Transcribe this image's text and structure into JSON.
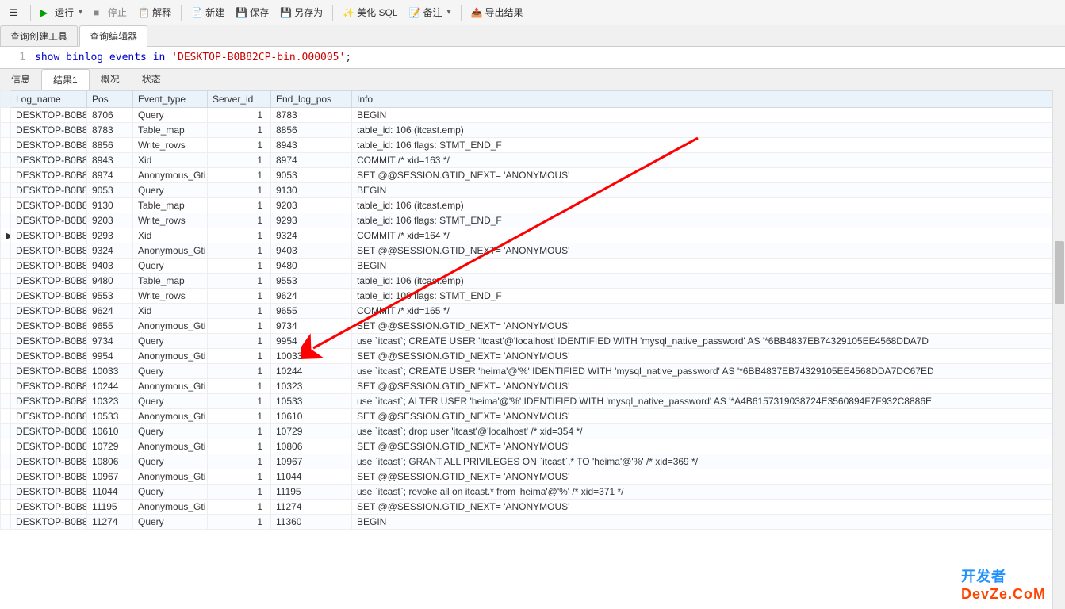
{
  "toolbar": {
    "run": "运行",
    "stop": "停止",
    "explain": "解释",
    "new": "新建",
    "save": "保存",
    "saveAs": "另存为",
    "beautify": "美化 SQL",
    "comment": "备注",
    "export": "导出结果"
  },
  "editorTabs": {
    "builder": "查询创建工具",
    "editor": "查询编辑器"
  },
  "sql": {
    "lineNum": "1",
    "part1": "show binlog events in ",
    "part2": "'DESKTOP-B0B82CP-bin.000005'",
    "part3": ";"
  },
  "resultTabs": {
    "info": "信息",
    "result1": "结果1",
    "profile": "概况",
    "status": "状态"
  },
  "columns": {
    "log_name": "Log_name",
    "pos": "Pos",
    "event_type": "Event_type",
    "server_id": "Server_id",
    "end_log_pos": "End_log_pos",
    "info": "Info"
  },
  "rows": [
    {
      "log": "DESKTOP-B0B8",
      "pos": "8706",
      "et": "Query",
      "sid": "1",
      "elp": "8783",
      "info": "BEGIN"
    },
    {
      "log": "DESKTOP-B0B8",
      "pos": "8783",
      "et": "Table_map",
      "sid": "1",
      "elp": "8856",
      "info": "table_id: 106 (itcast.emp)"
    },
    {
      "log": "DESKTOP-B0B8",
      "pos": "8856",
      "et": "Write_rows",
      "sid": "1",
      "elp": "8943",
      "info": "table_id: 106 flags: STMT_END_F"
    },
    {
      "log": "DESKTOP-B0B8",
      "pos": "8943",
      "et": "Xid",
      "sid": "1",
      "elp": "8974",
      "info": "COMMIT /* xid=163 */"
    },
    {
      "log": "DESKTOP-B0B8",
      "pos": "8974",
      "et": "Anonymous_Gti",
      "sid": "1",
      "elp": "9053",
      "info": "SET @@SESSION.GTID_NEXT= 'ANONYMOUS'"
    },
    {
      "log": "DESKTOP-B0B8",
      "pos": "9053",
      "et": "Query",
      "sid": "1",
      "elp": "9130",
      "info": "BEGIN"
    },
    {
      "log": "DESKTOP-B0B8",
      "pos": "9130",
      "et": "Table_map",
      "sid": "1",
      "elp": "9203",
      "info": "table_id: 106 (itcast.emp)"
    },
    {
      "log": "DESKTOP-B0B8",
      "pos": "9203",
      "et": "Write_rows",
      "sid": "1",
      "elp": "9293",
      "info": "table_id: 106 flags: STMT_END_F"
    },
    {
      "log": "DESKTOP-B0B8",
      "pos": "9293",
      "et": "Xid",
      "sid": "1",
      "elp": "9324",
      "info": "COMMIT /* xid=164 */",
      "marker": "▶"
    },
    {
      "log": "DESKTOP-B0B8",
      "pos": "9324",
      "et": "Anonymous_Gti",
      "sid": "1",
      "elp": "9403",
      "info": "SET @@SESSION.GTID_NEXT= 'ANONYMOUS'"
    },
    {
      "log": "DESKTOP-B0B8",
      "pos": "9403",
      "et": "Query",
      "sid": "1",
      "elp": "9480",
      "info": "BEGIN"
    },
    {
      "log": "DESKTOP-B0B8",
      "pos": "9480",
      "et": "Table_map",
      "sid": "1",
      "elp": "9553",
      "info": "table_id: 106 (itcast.emp)"
    },
    {
      "log": "DESKTOP-B0B8",
      "pos": "9553",
      "et": "Write_rows",
      "sid": "1",
      "elp": "9624",
      "info": "table_id: 106 flags: STMT_END_F"
    },
    {
      "log": "DESKTOP-B0B8",
      "pos": "9624",
      "et": "Xid",
      "sid": "1",
      "elp": "9655",
      "info": "COMMIT /* xid=165 */"
    },
    {
      "log": "DESKTOP-B0B8",
      "pos": "9655",
      "et": "Anonymous_Gti",
      "sid": "1",
      "elp": "9734",
      "info": "SET @@SESSION.GTID_NEXT= 'ANONYMOUS'"
    },
    {
      "log": "DESKTOP-B0B8",
      "pos": "9734",
      "et": "Query",
      "sid": "1",
      "elp": "9954",
      "info": "use `itcast`; CREATE USER 'itcast'@'localhost' IDENTIFIED WITH 'mysql_native_password' AS '*6BB4837EB74329105EE4568DDA7D"
    },
    {
      "log": "DESKTOP-B0B8",
      "pos": "9954",
      "et": "Anonymous_Gti",
      "sid": "1",
      "elp": "10033",
      "info": "SET @@SESSION.GTID_NEXT= 'ANONYMOUS'"
    },
    {
      "log": "DESKTOP-B0B8",
      "pos": "10033",
      "et": "Query",
      "sid": "1",
      "elp": "10244",
      "info": "use `itcast`; CREATE USER 'heima'@'%' IDENTIFIED WITH 'mysql_native_password' AS '*6BB4837EB74329105EE4568DDA7DC67ED"
    },
    {
      "log": "DESKTOP-B0B8",
      "pos": "10244",
      "et": "Anonymous_Gti",
      "sid": "1",
      "elp": "10323",
      "info": "SET @@SESSION.GTID_NEXT= 'ANONYMOUS'"
    },
    {
      "log": "DESKTOP-B0B8",
      "pos": "10323",
      "et": "Query",
      "sid": "1",
      "elp": "10533",
      "info": "use `itcast`; ALTER USER 'heima'@'%' IDENTIFIED WITH 'mysql_native_password' AS '*A4B6157319038724E3560894F7F932C8886E"
    },
    {
      "log": "DESKTOP-B0B8",
      "pos": "10533",
      "et": "Anonymous_Gti",
      "sid": "1",
      "elp": "10610",
      "info": "SET @@SESSION.GTID_NEXT= 'ANONYMOUS'"
    },
    {
      "log": "DESKTOP-B0B8",
      "pos": "10610",
      "et": "Query",
      "sid": "1",
      "elp": "10729",
      "info": "use `itcast`; drop user 'itcast'@'localhost' /* xid=354 */"
    },
    {
      "log": "DESKTOP-B0B8",
      "pos": "10729",
      "et": "Anonymous_Gti",
      "sid": "1",
      "elp": "10806",
      "info": "SET @@SESSION.GTID_NEXT= 'ANONYMOUS'"
    },
    {
      "log": "DESKTOP-B0B8",
      "pos": "10806",
      "et": "Query",
      "sid": "1",
      "elp": "10967",
      "info": "use `itcast`; GRANT ALL PRIVILEGES ON `itcast`.* TO 'heima'@'%' /* xid=369 */"
    },
    {
      "log": "DESKTOP-B0B8",
      "pos": "10967",
      "et": "Anonymous_Gti",
      "sid": "1",
      "elp": "11044",
      "info": "SET @@SESSION.GTID_NEXT= 'ANONYMOUS'"
    },
    {
      "log": "DESKTOP-B0B8",
      "pos": "11044",
      "et": "Query",
      "sid": "1",
      "elp": "11195",
      "info": "use `itcast`; revoke all on itcast.* from 'heima'@'%' /* xid=371 */"
    },
    {
      "log": "DESKTOP-B0B8",
      "pos": "11195",
      "et": "Anonymous_Gti",
      "sid": "1",
      "elp": "11274",
      "info": "SET @@SESSION.GTID_NEXT= 'ANONYMOUS'"
    },
    {
      "log": "DESKTOP-B0B8",
      "pos": "11274",
      "et": "Query",
      "sid": "1",
      "elp": "11360",
      "info": "BEGIN"
    }
  ],
  "watermark": {
    "line1": "开发者",
    "line2": "DevZe.CoM"
  }
}
